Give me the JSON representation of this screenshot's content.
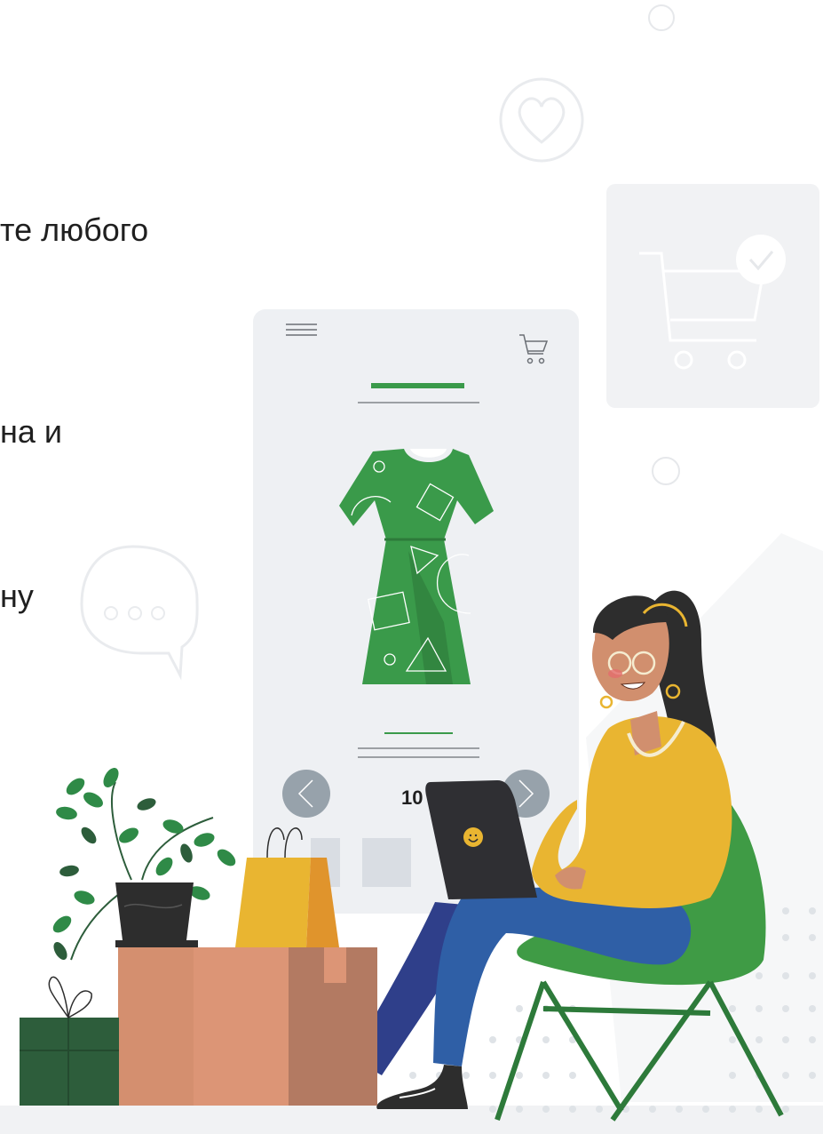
{
  "text_fragments": {
    "line1": "те любого",
    "line2": "на и",
    "line3": "ну"
  },
  "phone": {
    "price_partial": "10"
  },
  "colors": {
    "dress_green": "#3a9a4a",
    "sweater_yellow": "#e9b531",
    "jeans_blue": "#2f5fa6",
    "chair_green": "#3f9b45",
    "box_brown": "#d48f6f",
    "gift_green": "#2d5d3b",
    "laptop_dark": "#2f2f33",
    "ui_gray": "#eef0f3"
  },
  "icons": [
    "menu-icon",
    "cart-icon",
    "heart-icon",
    "chat-bubble-icon",
    "check-cart-icon",
    "arrow-left-icon",
    "arrow-right-icon"
  ]
}
